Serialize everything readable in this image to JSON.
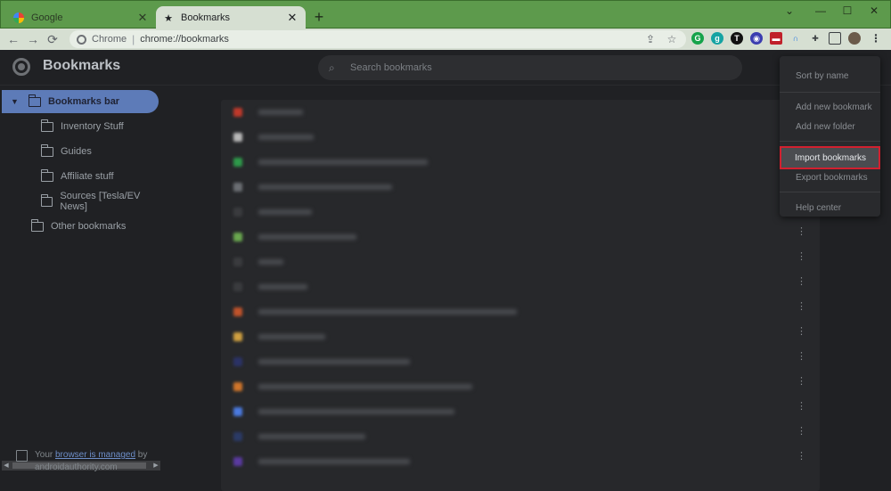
{
  "tabs": [
    {
      "title": "Google",
      "icon": "google-icon",
      "active": false
    },
    {
      "title": "Bookmarks",
      "icon": "star-icon",
      "active": true
    }
  ],
  "omnibox": {
    "site": "Chrome",
    "url": "chrome://bookmarks"
  },
  "header": {
    "title": "Bookmarks",
    "search_placeholder": "Search bookmarks"
  },
  "sidebar": {
    "folders": [
      {
        "label": "Bookmarks bar",
        "selected": true
      },
      {
        "label": "Inventory Stuff"
      },
      {
        "label": "Guides"
      },
      {
        "label": "Affiliate stuff"
      },
      {
        "label": "Sources [Tesla/EV News]"
      },
      {
        "label": "Other bookmarks"
      }
    ]
  },
  "managed": {
    "prefix": "Your ",
    "link": "browser is managed",
    "suffix": " by",
    "domain": "androidauthority.com"
  },
  "menu": {
    "items": [
      {
        "label": "Sort by name"
      },
      {
        "label": "Add new bookmark"
      },
      {
        "label": "Add new folder"
      },
      {
        "label": "Import bookmarks",
        "highlighted": true
      },
      {
        "label": "Export bookmarks"
      },
      {
        "label": "Help center"
      }
    ]
  },
  "colors": {
    "tabstrip": "#5d9a4c",
    "selected_folder": "#5d7bb8",
    "highlight_border": "#d2202f",
    "favicons": [
      "#c0392b",
      "#b8b8b8",
      "#2e9a4a",
      "#6b6e73",
      "#3a3b3e",
      "#6aa84f",
      "#3a3b3e",
      "#3a3b3e",
      "#c0532b",
      "#d0a040",
      "#2b3266",
      "#d0752b",
      "#4a7ae0",
      "#2b3a66",
      "#5a3aa0"
    ]
  }
}
